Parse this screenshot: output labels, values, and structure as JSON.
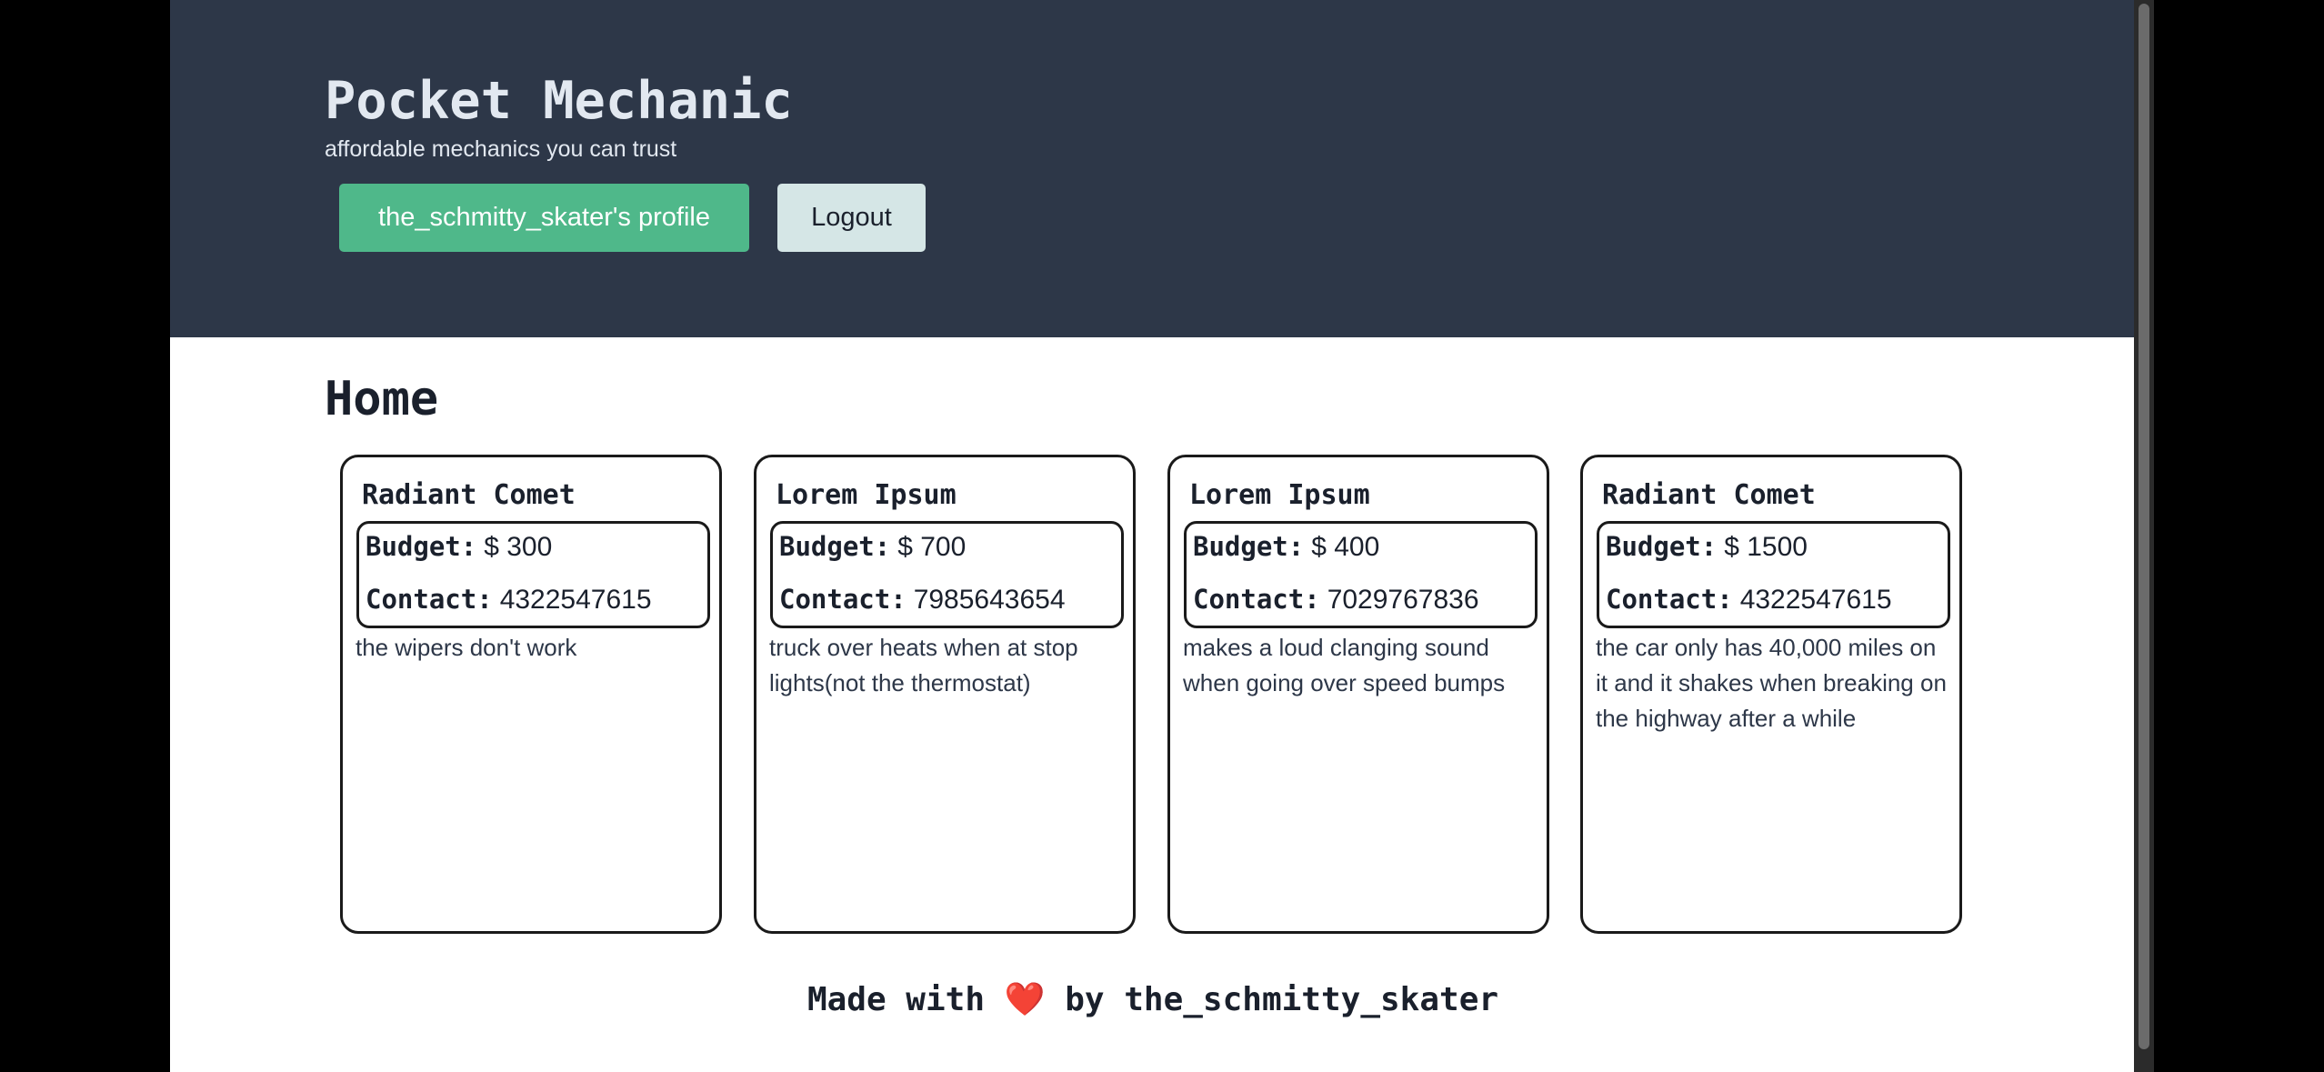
{
  "header": {
    "title": "Pocket Mechanic",
    "tagline": "affordable mechanics you can trust",
    "profile_button": "the_schmitty_skater's profile",
    "logout_button": "Logout"
  },
  "main": {
    "heading": "Home",
    "budget_label": "Budget:",
    "contact_label": "Contact:",
    "cards": [
      {
        "title": "Radiant Comet",
        "budget": "$ 300",
        "contact": "4322547615",
        "description": "the wipers don't work"
      },
      {
        "title": "Lorem Ipsum",
        "budget": "$ 700",
        "contact": "7985643654",
        "description": "truck over heats when at stop lights(not the thermostat)"
      },
      {
        "title": "Lorem Ipsum",
        "budget": "$ 400",
        "contact": "7029767836",
        "description": "makes a loud clanging sound when going over speed bumps"
      },
      {
        "title": "Radiant Comet",
        "budget": "$ 1500",
        "contact": "4322547615",
        "description": "the car only has 40,000 miles on it and it shakes when breaking on the highway after a while"
      }
    ]
  },
  "footer": {
    "prefix": "Made with",
    "heart": "❤️",
    "suffix": "by the_schmitty_skater"
  },
  "colors": {
    "header_bg": "#2d3748",
    "profile_button_bg": "#4fb88a",
    "logout_button_bg": "#d5e6e6",
    "heart": "#e53e3e"
  },
  "icons": {
    "heart": "heart-icon"
  }
}
